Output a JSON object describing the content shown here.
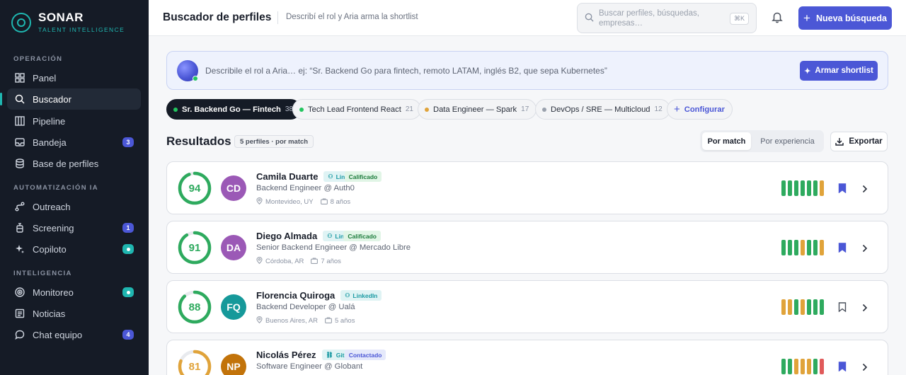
{
  "brand": {
    "name": "SONAR",
    "tagline": "TALENT INTELLIGENCE"
  },
  "sidebar": {
    "sections": [
      {
        "label": "OPERACIÓN"
      },
      {
        "label": "AUTOMATIZACIÓN IA"
      },
      {
        "label": "INTELIGENCIA"
      }
    ],
    "items": [
      {
        "label": "Panel",
        "icon": "grid-icon"
      },
      {
        "label": "Buscador",
        "icon": "search-icon",
        "active": true
      },
      {
        "label": "Pipeline",
        "icon": "columns-icon"
      },
      {
        "label": "Bandeja",
        "icon": "inbox-icon",
        "badge": "3"
      },
      {
        "label": "Base de perfiles",
        "icon": "database-icon"
      },
      {
        "label": "Outreach",
        "icon": "route-icon"
      },
      {
        "label": "Screening",
        "icon": "flask-icon",
        "badge": "1"
      },
      {
        "label": "Copiloto",
        "icon": "sparkle-icon",
        "badge_dot": true
      },
      {
        "label": "Monitoreo",
        "icon": "radar-icon",
        "badge_dot": true
      },
      {
        "label": "Noticias",
        "icon": "newspaper-icon"
      },
      {
        "label": "Chat equipo",
        "icon": "chat-icon",
        "badge": "4"
      }
    ]
  },
  "header": {
    "title": "Buscador de perfiles",
    "subtitle": "Describí el rol y Aria arma la shortlist",
    "search_placeholder": "Buscar perfiles, búsquedas, empresas…",
    "search_shortcut": "⌘K",
    "new_search_label": "Nueva búsqueda"
  },
  "prompt": {
    "placeholder": "Describile el rol a Aria… ej: “Sr. Backend Go para fintech, remoto LATAM, inglés B2, que sepa Kubernetes”",
    "button_label": "Armar shortlist"
  },
  "searches": [
    {
      "label": "Sr. Backend Go — Fintech",
      "count": "38",
      "dot_color": "#22c55e",
      "active": true
    },
    {
      "label": "Tech Lead Frontend React",
      "count": "21",
      "dot_color": "#22c55e"
    },
    {
      "label": "Data Engineer — Spark",
      "count": "17",
      "dot_color": "#e0a33a"
    },
    {
      "label": "DevOps / SRE — Multicloud",
      "count": "12",
      "dot_color": "#9aa1ad"
    }
  ],
  "configure_label": "Configurar",
  "results": {
    "title": "Resultados",
    "count_label": "5 perfiles · por match",
    "sort_options": [
      "Por match",
      "Por experiencia"
    ],
    "sort_selected": "Por match",
    "export_label": "Exportar"
  },
  "colors": {
    "accent": "#4b57d6",
    "teal": "#1fb6b0",
    "green": "#2eaa5e",
    "amber": "#e0a33a",
    "red": "#e05a5a"
  },
  "candidates": [
    {
      "score": 94,
      "initials": "CD",
      "avatar_color": "#9b59b6",
      "name": "Camila Duarte",
      "source": "LinkedIn",
      "status": "Calificado",
      "role": "Backend Engineer @ Auth0",
      "location": "Montevideo, UY",
      "experience": "8 años",
      "bars": [
        "green",
        "green",
        "green",
        "green",
        "green",
        "green",
        "amber"
      ],
      "saved": true
    },
    {
      "score": 91,
      "initials": "DA",
      "avatar_color": "#9b59b6",
      "name": "Diego Almada",
      "source": "LinkedIn",
      "status": "Calificado",
      "role": "Senior Backend Engineer @ Mercado Libre",
      "location": "Córdoba, AR",
      "experience": "7 años",
      "bars": [
        "green",
        "green",
        "green",
        "amber",
        "green",
        "green",
        "amber"
      ],
      "saved": true
    },
    {
      "score": 88,
      "initials": "FQ",
      "avatar_color": "#16999a",
      "name": "Florencia Quiroga",
      "source": "LinkedIn",
      "status": "",
      "role": "Backend Developer @ Ualá",
      "location": "Buenos Aires, AR",
      "experience": "5 años",
      "bars": [
        "amber",
        "amber",
        "green",
        "amber",
        "green",
        "green",
        "green"
      ],
      "saved": false
    },
    {
      "score": 81,
      "initials": "NP",
      "avatar_color": "#c2730a",
      "name": "Nicolás Pérez",
      "source": "GitHub",
      "status": "Contactado",
      "role": "Software Engineer @ Globant",
      "location": "",
      "experience": "",
      "bars": [
        "green",
        "green",
        "amber",
        "amber",
        "amber",
        "green",
        "red"
      ],
      "saved": true
    }
  ]
}
